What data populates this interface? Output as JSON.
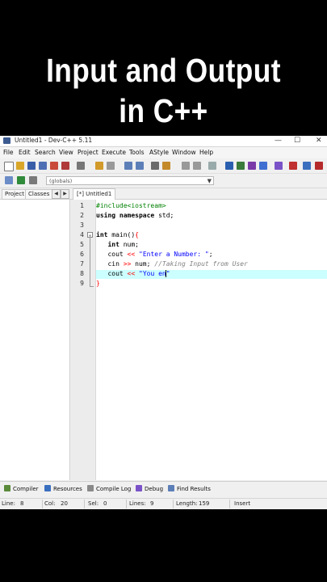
{
  "banner": {
    "line1": "Input and Output",
    "line2": "in C++"
  },
  "window": {
    "title": "Untitled1 - Dev-C++ 5.11",
    "minimize": "—",
    "maximize": "☐",
    "close": "✕"
  },
  "menu": [
    "File",
    "Edit",
    "Search",
    "View",
    "Project",
    "Execute",
    "Tools",
    "AStyle",
    "Window",
    "Help"
  ],
  "toolbar2": {
    "globals_value": "(globals)"
  },
  "left_tabs": [
    "Project",
    "Classes"
  ],
  "editor_tab": "[*] Untitled1",
  "code_lines": [
    {
      "n": "1"
    },
    {
      "n": "2"
    },
    {
      "n": "3"
    },
    {
      "n": "4"
    },
    {
      "n": "5"
    },
    {
      "n": "6"
    },
    {
      "n": "7"
    },
    {
      "n": "8"
    },
    {
      "n": "9"
    }
  ],
  "code": {
    "l1": "#include<iostream>",
    "l2_kw": "using namespace",
    "l2_rest": " std;",
    "l4_kw": "int",
    "l4_rest": " main()",
    "l4_brace": "{",
    "l5_kw": "int",
    "l5_rest": " num;",
    "l6_a": "cout ",
    "l6_op": "<<",
    "l6_str": " \"Enter a Number: \"",
    "l6_end": ";",
    "l7_a": "cin ",
    "l7_op": ">>",
    "l7_b": " num; ",
    "l7_cm": "//Taking Input from User",
    "l8_a": "cout ",
    "l8_op": "<<",
    "l8_str": " \"You en",
    "l9": "}"
  },
  "bottom_tabs": [
    "Compiler",
    "Resources",
    "Compile Log",
    "Debug",
    "Find Results"
  ],
  "status": {
    "line_label": "Line:",
    "line_value": "8",
    "col_label": "Col:",
    "col_value": "20",
    "sel_label": "Sel:",
    "sel_value": "0",
    "lines_label": "Lines:",
    "lines_value": "9",
    "length_label": "Length:",
    "length_value": "159",
    "mode": "Insert"
  },
  "colors": {
    "current_line": "#ccffff",
    "preprocessor": "#008000",
    "string": "#0000ff",
    "operator": "#ff0000",
    "comment": "#808080"
  }
}
